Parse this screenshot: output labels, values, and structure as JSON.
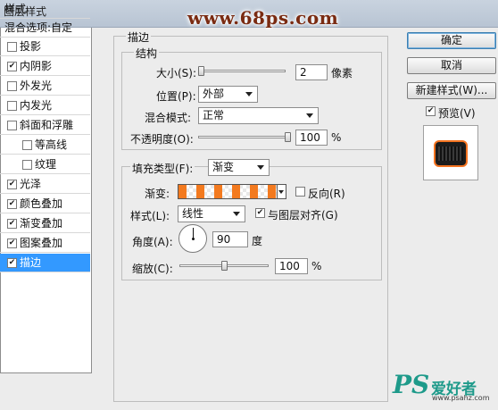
{
  "window": {
    "title": "图层样式"
  },
  "watermark": "www.68ps.com",
  "left_panel": {
    "header": "样式",
    "blend_options": "混合选项:自定",
    "items": [
      {
        "label": "投影",
        "checked": false,
        "indent": false,
        "selected": false
      },
      {
        "label": "内阴影",
        "checked": true,
        "indent": false,
        "selected": false
      },
      {
        "label": "外发光",
        "checked": false,
        "indent": false,
        "selected": false
      },
      {
        "label": "内发光",
        "checked": false,
        "indent": false,
        "selected": false
      },
      {
        "label": "斜面和浮雕",
        "checked": false,
        "indent": false,
        "selected": false
      },
      {
        "label": "等高线",
        "checked": false,
        "indent": true,
        "selected": false
      },
      {
        "label": "纹理",
        "checked": false,
        "indent": true,
        "selected": false
      },
      {
        "label": "光泽",
        "checked": true,
        "indent": false,
        "selected": false
      },
      {
        "label": "颜色叠加",
        "checked": true,
        "indent": false,
        "selected": false
      },
      {
        "label": "渐变叠加",
        "checked": true,
        "indent": false,
        "selected": false
      },
      {
        "label": "图案叠加",
        "checked": true,
        "indent": false,
        "selected": false
      },
      {
        "label": "描边",
        "checked": true,
        "indent": false,
        "selected": true
      }
    ]
  },
  "stroke": {
    "section_title": "描边",
    "structure": {
      "title": "结构",
      "size_label": "大小(S):",
      "size_value": "2",
      "size_unit": "像素",
      "size_fraction": 0.0,
      "position_label": "位置(P):",
      "position_value": "外部",
      "blend_label": "混合模式:",
      "blend_value": "正常",
      "opacity_label": "不透明度(O):",
      "opacity_value": "100",
      "opacity_unit": "%",
      "opacity_fraction": 1.0
    },
    "fill": {
      "type_label": "填充类型(F):",
      "type_value": "渐变",
      "gradient_label": "渐变:",
      "gradient_colors": [
        "#f37a1f",
        "#ffffff"
      ],
      "reverse_label": "反向(R)",
      "reverse_checked": false,
      "style_label": "样式(L):",
      "style_value": "线性",
      "align_label": "与图层对齐(G)",
      "align_checked": true,
      "angle_label": "角度(A):",
      "angle_value": "90",
      "angle_unit": "度",
      "scale_label": "缩放(C):",
      "scale_value": "100",
      "scale_unit": "%",
      "scale_fraction": 0.5
    }
  },
  "buttons": {
    "ok": "确定",
    "cancel": "取消",
    "new_style": "新建样式(W)...",
    "preview": "预览(V)",
    "preview_checked": true
  },
  "brand": {
    "logo": "PS",
    "cn": "爱好者",
    "url": "www.psahz.com"
  },
  "colors": {
    "accent": "#3399ff",
    "stroke_gradient": "#f37a1f",
    "brand": "#1e9a8a",
    "watermark": "#7a2b12"
  }
}
